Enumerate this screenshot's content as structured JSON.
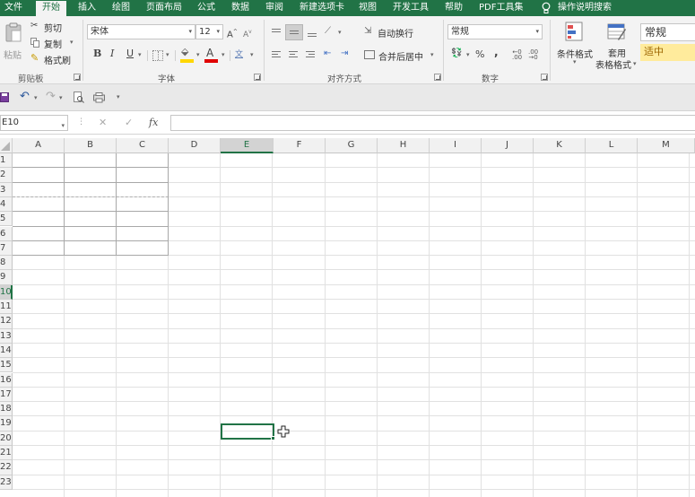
{
  "tabs": [
    "文件",
    "开始",
    "插入",
    "绘图",
    "页面布局",
    "公式",
    "数据",
    "审阅",
    "新建选项卡",
    "视图",
    "开发工具",
    "帮助",
    "PDF工具集",
    "操作说明搜索"
  ],
  "clipboard": {
    "paste": "粘贴",
    "cut": "剪切",
    "copy": "复制",
    "format_painter": "格式刷",
    "label": "剪贴板"
  },
  "font": {
    "name": "宋体",
    "size": "12",
    "bold": "B",
    "italic": "I",
    "underline": "U",
    "grow": "A",
    "shrink": "A",
    "font_color_glyph": "A",
    "highlight_color": "#ffd700",
    "font_color": "#e00000",
    "label": "字体"
  },
  "alignment": {
    "wrap_text": "自动换行",
    "merge_center": "合并后居中",
    "label": "对齐方式"
  },
  "number": {
    "format": "常规",
    "percent": "%",
    "comma": ",",
    "label": "数字"
  },
  "styles": {
    "conditional_format": "条件格式",
    "table_format_line1": "套用",
    "table_format_line2": "表格格式",
    "normal": "常规",
    "neutral": "适中",
    "neutral_bg": "#ffeb9c",
    "neutral_fg": "#9c6500"
  },
  "formula_bar": {
    "name_box": "E10",
    "cancel": "✕",
    "enter": "✓",
    "fx": "fx",
    "value": ""
  },
  "columns": [
    "A",
    "B",
    "C",
    "D",
    "E",
    "F",
    "G",
    "H",
    "I",
    "J",
    "K",
    "L",
    "M"
  ],
  "rows": [
    "1",
    "2",
    "3",
    "4",
    "5",
    "6",
    "7",
    "8",
    "9",
    "10",
    "11",
    "12",
    "13",
    "14",
    "15",
    "16",
    "17",
    "18",
    "19",
    "20",
    "21",
    "22",
    "23"
  ],
  "selected_cell": "E10",
  "accent_color": "#217346"
}
